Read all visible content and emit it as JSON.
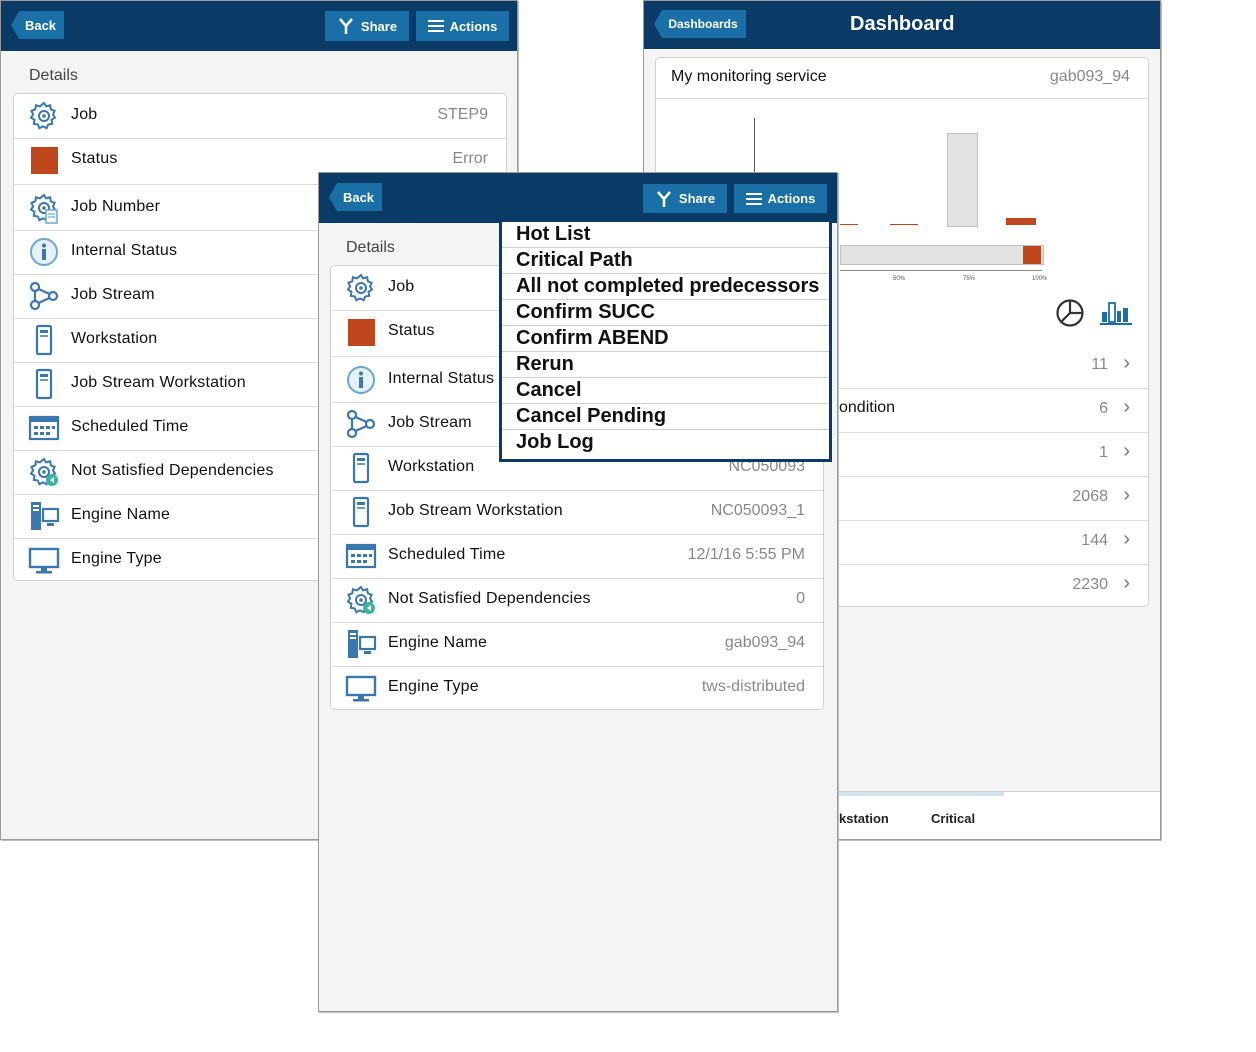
{
  "left": {
    "back_label": "Back",
    "share_label": "Share",
    "actions_label": "Actions",
    "details_label": "Details",
    "rows": [
      {
        "label": "Job",
        "value": "STEP9",
        "icon": "gear-icon"
      },
      {
        "label": "Status",
        "value": "Error",
        "icon": "status-square-icon"
      },
      {
        "label": "Job Number",
        "value": "",
        "icon": "gear-doc-icon"
      },
      {
        "label": "Internal Status",
        "value": "",
        "icon": "info-icon"
      },
      {
        "label": "Job Stream",
        "value": "",
        "icon": "job-stream-icon"
      },
      {
        "label": "Workstation",
        "value": "",
        "icon": "workstation-icon"
      },
      {
        "label": "Job Stream Workstation",
        "value": "",
        "icon": "workstation-icon"
      },
      {
        "label": "Scheduled Time",
        "value": "",
        "icon": "calendar-icon"
      },
      {
        "label": "Not Satisfied Dependencies",
        "value": "",
        "icon": "gear-dependency-icon"
      },
      {
        "label": "Engine Name",
        "value": "",
        "icon": "server-icon"
      },
      {
        "label": "Engine Type",
        "value": "",
        "icon": "monitor-icon"
      }
    ]
  },
  "right": {
    "dashboards_label": "Dashboards",
    "title": "Dashboard",
    "service_title": "My monitoring service",
    "engine": "gab093_94",
    "axis_ticks": [
      "50%",
      "75%",
      "100%"
    ],
    "list": [
      {
        "label": "",
        "count": "11"
      },
      {
        "label": "ondition",
        "count": "6"
      },
      {
        "label": "",
        "count": "1"
      },
      {
        "label": "",
        "count": "2068"
      },
      {
        "label": "",
        "count": "144"
      },
      {
        "label": "",
        "count": "2230"
      }
    ],
    "tabs": [
      "kstation",
      "Critical"
    ]
  },
  "front": {
    "back_label": "Back",
    "share_label": "Share",
    "actions_label": "Actions",
    "details_label": "Details",
    "rows": [
      {
        "label": "Job",
        "value": "",
        "icon": "gear-icon"
      },
      {
        "label": "Status",
        "value": "",
        "icon": "status-square-icon"
      },
      {
        "label": "Internal Status",
        "value": "",
        "icon": "info-icon"
      },
      {
        "label": "Job Stream",
        "value": "",
        "icon": "job-stream-icon"
      },
      {
        "label": "Workstation",
        "value": "NC050093",
        "icon": "workstation-icon"
      },
      {
        "label": "Job Stream Workstation",
        "value": "NC050093_1",
        "icon": "workstation-icon"
      },
      {
        "label": "Scheduled Time",
        "value": "12/1/16 5:55 PM",
        "icon": "calendar-icon"
      },
      {
        "label": "Not Satisfied Dependencies",
        "value": "0",
        "icon": "gear-dependency-icon"
      },
      {
        "label": "Engine Name",
        "value": "gab093_94",
        "icon": "server-icon"
      },
      {
        "label": "Engine Type",
        "value": "tws-distributed",
        "icon": "monitor-icon"
      }
    ],
    "menu": [
      "Hot List",
      "Critical Path",
      "All not completed predecessors",
      "Confirm SUCC",
      "Confirm ABEND",
      "Rerun",
      "Cancel",
      "Cancel Pending",
      "Job Log"
    ]
  },
  "colors": {
    "header": "#0a3a66",
    "button": "#1a6fa6",
    "status_error": "#c0461d",
    "icon_blue": "#3a76b0"
  }
}
